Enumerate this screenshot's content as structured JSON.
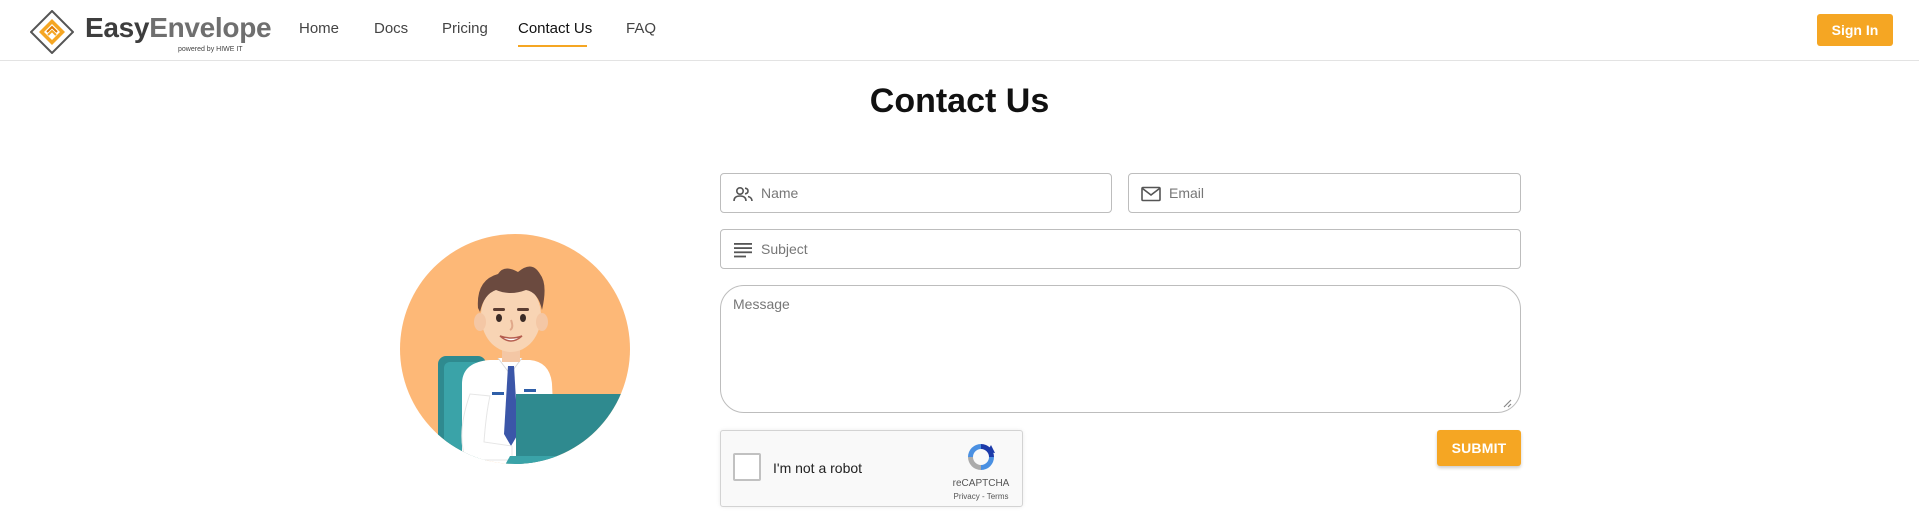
{
  "brand": {
    "name_part1": "Easy",
    "name_part2": "Envelope",
    "tagline": "powered by HIWE IT",
    "accent_color": "#f5a623"
  },
  "nav": {
    "items": [
      {
        "label": "Home",
        "active": false
      },
      {
        "label": "Docs",
        "active": false
      },
      {
        "label": "Pricing",
        "active": false
      },
      {
        "label": "Contact Us",
        "active": true
      },
      {
        "label": "FAQ",
        "active": false
      }
    ],
    "signin_label": "Sign In"
  },
  "page": {
    "title": "Contact Us"
  },
  "form": {
    "name": {
      "placeholder": "Name",
      "value": "",
      "icon": "people-icon"
    },
    "email": {
      "placeholder": "Email",
      "value": "",
      "icon": "mail-icon"
    },
    "subject": {
      "placeholder": "Subject",
      "value": "",
      "icon": "subject-lines-icon"
    },
    "message": {
      "placeholder": "Message",
      "value": ""
    },
    "submit_label": "SUBMIT"
  },
  "recaptcha": {
    "label": "I'm not a robot",
    "brand": "reCAPTCHA",
    "privacy": "Privacy",
    "separator": " - ",
    "terms": "Terms",
    "checked": false
  }
}
